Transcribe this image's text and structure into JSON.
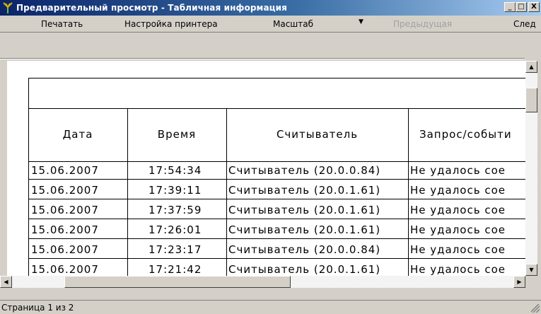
{
  "window": {
    "title": "Предварительный просмотр - Табличная информация",
    "buttons": {
      "minimize": "_",
      "maximize": "□",
      "close": "X"
    }
  },
  "toolbar": {
    "print": "Печатать",
    "printer_setup": "Настройка принтера",
    "zoom": "Масштаб",
    "zoom_arrow": "▼",
    "previous": "Предыдущая",
    "next": "След"
  },
  "table": {
    "columns": [
      "Дата",
      "Время",
      "Считыватель",
      "Запрос/событи"
    ],
    "rows": [
      [
        "15.06.2007",
        "17:54:34",
        "Считыватель (20.0.0.84)",
        "Не удалось сое"
      ],
      [
        "15.06.2007",
        "17:39:11",
        "Считыватель (20.0.1.61)",
        "Не удалось сое"
      ],
      [
        "15.06.2007",
        "17:37:59",
        "Считыватель (20.0.1.61)",
        "Не удалось сое"
      ],
      [
        "15.06.2007",
        "17:26:01",
        "Считыватель (20.0.1.61)",
        "Не удалось сое"
      ],
      [
        "15.06.2007",
        "17:23:17",
        "Считыватель (20.0.0.84)",
        "Не удалось сое"
      ],
      [
        "15.06.2007",
        "17:21:42",
        "Считыватель (20.0.1.61)",
        "Не удалось сое"
      ]
    ]
  },
  "status": {
    "page": "Страница 1 из 2"
  },
  "icons": {
    "app": "app-icon",
    "scroll_up": "▲",
    "scroll_down": "▼",
    "scroll_left": "◀",
    "scroll_right": "▶"
  }
}
